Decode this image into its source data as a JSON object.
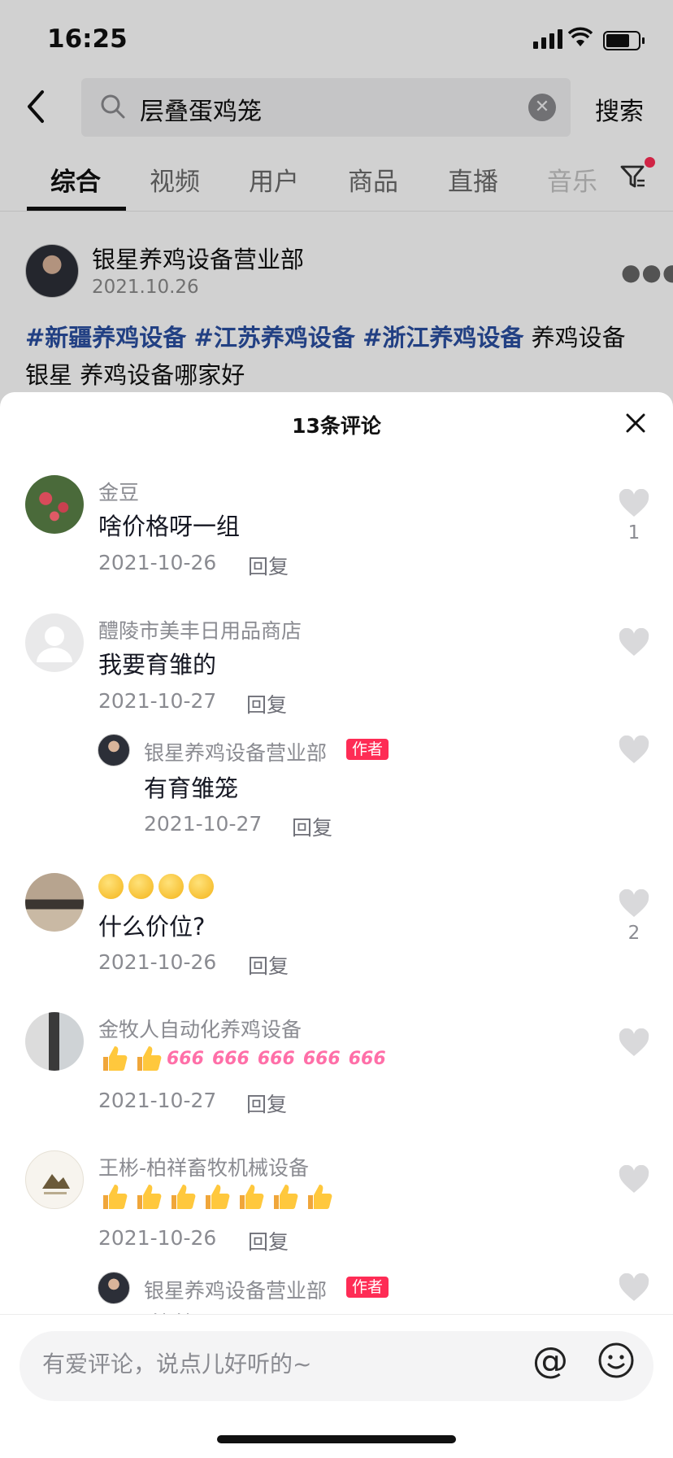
{
  "status_bar": {
    "time": "16:25"
  },
  "search": {
    "query": "层叠蛋鸡笼",
    "submit_label": "搜索"
  },
  "tabs": [
    {
      "label": "综合",
      "active": true
    },
    {
      "label": "视频"
    },
    {
      "label": "用户"
    },
    {
      "label": "商品"
    },
    {
      "label": "直播"
    },
    {
      "label": "音乐"
    }
  ],
  "post": {
    "author": "银星养鸡设备营业部",
    "date": "2021.10.26",
    "hashtags": [
      "#新疆养鸡设备",
      "#江苏养鸡设备",
      "#浙江养鸡设备"
    ],
    "text_after_tags": "养鸡设备",
    "text_line2": "银星 养鸡设备哪家好"
  },
  "comments_sheet": {
    "title": "13条评论",
    "reply_label": "回复",
    "author_badge": "作者",
    "comments": [
      {
        "name": "金豆",
        "text": "啥价格呀一组",
        "date": "2021-10-26",
        "likes": "1"
      },
      {
        "name": "醴陵市美丰日用品商店",
        "text": "我要育雏的",
        "date": "2021-10-27",
        "likes": ""
      },
      {
        "name": "",
        "text": "什么价位?",
        "date": "2021-10-26",
        "likes": "2"
      },
      {
        "name": "金牧人自动化养鸡设备",
        "text": "",
        "date": "2021-10-27",
        "likes": ""
      },
      {
        "name": "王彬-柏祥畜牧机械设备",
        "text": "",
        "date": "2021-10-26",
        "likes": ""
      }
    ],
    "replies": [
      {
        "name": "银星养鸡设备营业部",
        "text": "有育雏笼",
        "date": "2021-10-27"
      },
      {
        "name": "银星养鸡设备营业部",
        "text": "谢谢"
      }
    ],
    "emoji_666": "666"
  },
  "input": {
    "placeholder": "有爱评论，说点儿好听的~"
  },
  "colors": {
    "accent": "#fe2c55",
    "hashtag": "#2a4fa0"
  },
  "icons": [
    "back-arrow-icon",
    "search-icon",
    "clear-icon",
    "filter-icon",
    "more-icon",
    "close-icon",
    "heart-icon",
    "at-icon",
    "emoji-icon"
  ]
}
